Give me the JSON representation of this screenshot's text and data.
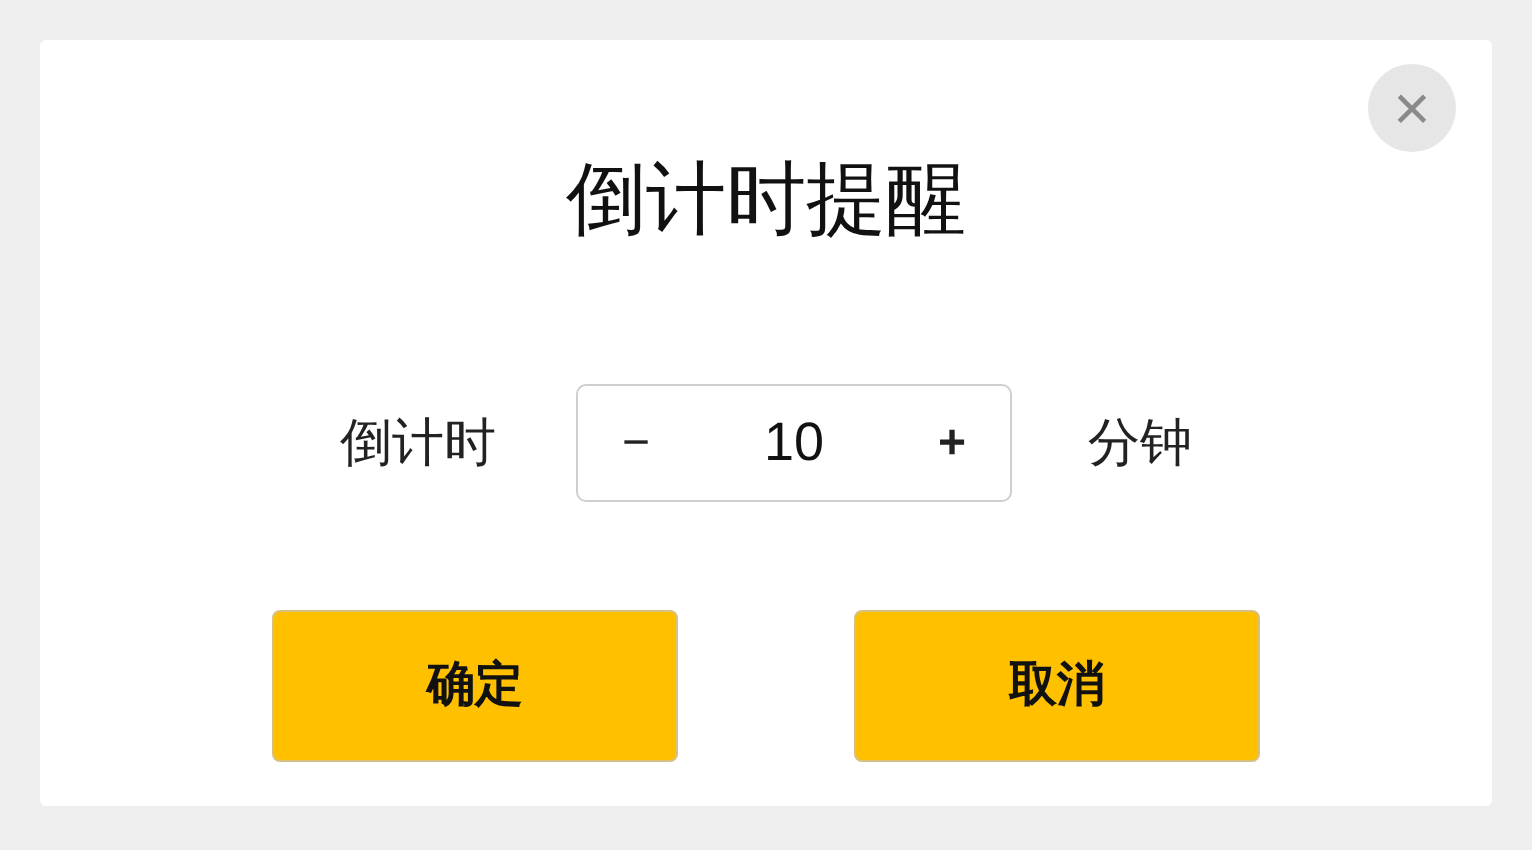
{
  "dialog": {
    "title": "倒计时提醒",
    "close": "×"
  },
  "countdown": {
    "label": "倒计时",
    "decrement": "−",
    "value": "10",
    "increment": "+",
    "unit": "分钟"
  },
  "buttons": [
    {
      "label": "确定"
    },
    {
      "label": "取消"
    }
  ]
}
